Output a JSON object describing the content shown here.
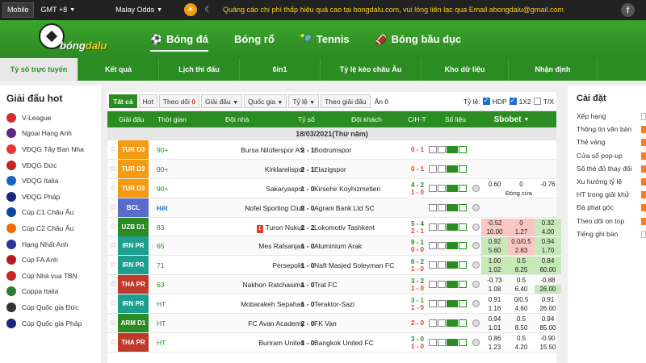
{
  "topbar": {
    "mobile": "Mobile",
    "timezone": "GMT +8",
    "odds_type": "Malay Odds",
    "promo": "Quảng cáo chi phí thấp hiệu quả cao tại bongdalu.com, vui lòng liên lạc qua Email abongdalu@gmail.com",
    "fb": "f"
  },
  "logo": {
    "text_a": "bóng",
    "text_b": "dalu"
  },
  "nav": [
    {
      "label": "Bóng đá",
      "icon": "soccer-ball-icon"
    },
    {
      "label": "Bóng rổ",
      "icon": ""
    },
    {
      "label": "Tennis",
      "icon": "tennis-icon"
    },
    {
      "label": "Bóng bầu dục",
      "icon": "rugby-icon"
    }
  ],
  "subnav": [
    "Tỷ số trực tuyến",
    "Kết quả",
    "Lịch thi đấu",
    "6in1",
    "Tỷ lệ kèo châu Âu",
    "Kho dữ liệu",
    "Nhận định"
  ],
  "left": {
    "title": "Giải đấu hot",
    "items": [
      {
        "label": "V-League",
        "color": "#d32f2f"
      },
      {
        "label": "Ngoại Hạng Anh",
        "color": "#5e2a84"
      },
      {
        "label": "VĐQG Tây Ban Nha",
        "color": "#e53935"
      },
      {
        "label": "VĐQG Đức",
        "color": "#c62828"
      },
      {
        "label": "VĐQG Italia",
        "color": "#1565c0"
      },
      {
        "label": "VĐQG Pháp",
        "color": "#1a237e"
      },
      {
        "label": "Cúp C1 Châu Âu",
        "color": "#0d47a1"
      },
      {
        "label": "Cúp C2 Châu Âu",
        "color": "#ef6c00"
      },
      {
        "label": "Hạng Nhất Anh",
        "color": "#283593"
      },
      {
        "label": "Cúp FA Anh",
        "color": "#b71c1c"
      },
      {
        "label": "Cúp Nhà vua TBN",
        "color": "#c62828"
      },
      {
        "label": "Coppa Italia",
        "color": "#2e7d32"
      },
      {
        "label": "Cúp Quốc gia Đức",
        "color": "#333333"
      },
      {
        "label": "Cúp Quốc gia Pháp",
        "color": "#1a237e"
      }
    ]
  },
  "filters": {
    "all": "Tất cả",
    "hot": "Hot",
    "follow": "Theo dõi",
    "follow_count": "0",
    "league": "Giải đấu",
    "country": "Quốc gia",
    "odds": "Tỷ lệ",
    "by_league": "Theo giải đấu",
    "hidden": "Ẩn",
    "hidden_count": "0",
    "odds_label": "Tỷ lệ:",
    "hdp": "HDP",
    "x12": "1X2",
    "tx": "T/X"
  },
  "thead": {
    "league": "Giải đấu",
    "time": "Thời gian",
    "home": "Đội nhà",
    "score": "Tỷ số",
    "away": "Đội khách",
    "ch": "C/H-T",
    "data": "Số liệu",
    "book": "Sbobet"
  },
  "date": "18/03/2021(Thứ năm)",
  "matches": [
    {
      "league": "TUR D3",
      "lc": "#f39c12",
      "time": "90+",
      "home": "Bursa Nilüferspor AS",
      "score": "2 - 1",
      "away": "Bodrumspor",
      "ch1": "0 - 1",
      "ch1c": "r",
      "ch2": "",
      "ch2c": "",
      "o1": [
        "",
        ""
      ],
      "o2": [
        "",
        ""
      ],
      "o3": [
        "",
        ""
      ]
    },
    {
      "league": "TUR D3",
      "lc": "#f39c12",
      "time": "90+",
      "home": "Kirklarelispor",
      "score": "2 - 1",
      "away": "Elazigspor",
      "ch1": "0 - 1",
      "ch1c": "r",
      "ch2": "",
      "ch2c": "",
      "o1": [
        "",
        ""
      ],
      "o2": [
        "",
        ""
      ],
      "o3": [
        "",
        ""
      ]
    },
    {
      "league": "TUR D3",
      "lc": "#f39c12",
      "time": "90+",
      "home": "Sakaryaspor",
      "score": "1 - 0",
      "away": "Kirsehir Koyhizmetleri",
      "ch1": "4 - 2",
      "ch1c": "g",
      "ch2": "1 - 0",
      "ch2c": "r",
      "o1": [
        "0.60",
        ""
      ],
      "o2": [
        "0",
        "Đóng cửa"
      ],
      "o3": [
        "-0.76",
        ""
      ]
    },
    {
      "league": "BCL",
      "lc": "#5b6cc8",
      "time": "Hết",
      "home": "Nofel Sporting Club",
      "score": "2 - 0",
      "away": "Agrani Bank Ltd SC",
      "ch1": "",
      "ch1c": "",
      "ch2": "",
      "ch2c": "",
      "o1": [
        "",
        ""
      ],
      "o2": [
        "",
        ""
      ],
      "o3": [
        "",
        ""
      ]
    },
    {
      "league": "UZB D1",
      "lc": "#2b8c23",
      "time": "83",
      "home": "Turon Nukus",
      "score": "2 - 2",
      "away": "Lokomotiv Tashkent",
      "ch1": "5 - 4",
      "ch1c": "g",
      "ch2": "2 - 1",
      "ch2c": "r",
      "o1": [
        "-0.52",
        "10.00"
      ],
      "o2": [
        "0",
        "1.27"
      ],
      "o3": [
        "0.32",
        "4.00"
      ],
      "red": "1"
    },
    {
      "league": "IRN PR",
      "lc": "#1e9e8e",
      "time": "65",
      "home": "Mes Rafsanjan",
      "score": "1 - 0",
      "away": "Aluminium Arak",
      "ch1": "9 - 1",
      "ch1c": "g",
      "ch2": "0 - 0",
      "ch2c": "r",
      "o1": [
        "0.92",
        "5.60"
      ],
      "o2": [
        "0.0/0.5",
        "2.83"
      ],
      "o3": [
        "0.94",
        "1.70"
      ]
    },
    {
      "league": "IRN PR",
      "lc": "#1e9e8e",
      "time": "71",
      "home": "Persepolis",
      "score": "1 - 0",
      "away": "Naft Masjed Soleyman FC",
      "ch1": "6 - 2",
      "ch1c": "g",
      "ch2": "1 - 0",
      "ch2c": "r",
      "o1": [
        "1.00",
        "1.02"
      ],
      "o2": [
        "0.5",
        "8.25"
      ],
      "o3": [
        "0.84",
        "60.00"
      ]
    },
    {
      "league": "THA PR",
      "lc": "#c0392b",
      "time": "63",
      "home": "Nakhon Ratchasima",
      "score": "1 - 0",
      "away": "Trat FC",
      "ch1": "3 - 2",
      "ch1c": "g",
      "ch2": "1 - 0",
      "ch2c": "r",
      "o1": [
        "-0.73",
        "1.08"
      ],
      "o2": [
        "0.5",
        "6.40"
      ],
      "o3": [
        "-0.88",
        "26.00"
      ]
    },
    {
      "league": "IRN PR",
      "lc": "#1e9e8e",
      "time": "HT",
      "home": "Mobarakeh Sepahan",
      "score": "1 - 0",
      "away": "Teraktor-Sazi",
      "ch1": "3 - 1",
      "ch1c": "g",
      "ch2": "1 - 0",
      "ch2c": "r",
      "o1": [
        "0.91",
        "1.16"
      ],
      "o2": [
        "0/0.5",
        "4.60"
      ],
      "o3": [
        "0.91",
        "26.00"
      ]
    },
    {
      "league": "ARM D1",
      "lc": "#2b8c23",
      "time": "HT",
      "home": "FC Avan Academy",
      "score": "2 - 0",
      "away": "FK Van",
      "ch1": "2 - 0",
      "ch1c": "r",
      "ch2": "",
      "ch2c": "",
      "o1": [
        "0.94",
        "1.01"
      ],
      "o2": [
        "0.5",
        "8.50"
      ],
      "o3": [
        "0.94",
        "85.00"
      ]
    },
    {
      "league": "THA PR",
      "lc": "#c0392b",
      "time": "HT",
      "home": "Buriram United",
      "score": "1 - 0",
      "away": "Bangkok United FC",
      "ch1": "3 - 0",
      "ch1c": "g",
      "ch2": "1 - 0",
      "ch2c": "r",
      "o1": [
        "0.86",
        "1.23"
      ],
      "o2": [
        "0.5",
        "4.20"
      ],
      "o3": [
        "-0.90",
        "15.50"
      ]
    }
  ],
  "right": {
    "title": "Cài đặt",
    "items": [
      {
        "label": "Xếp hạng",
        "on": false
      },
      {
        "label": "Thông tin văn bản",
        "on": true
      },
      {
        "label": "Thẻ vàng",
        "on": true
      },
      {
        "label": "Cửa sổ pop-up",
        "on": true
      },
      {
        "label": "Số thẻ đỏ thay đổi",
        "on": true
      },
      {
        "label": "Xu hướng tỷ lệ",
        "on": true
      },
      {
        "label": "HT trong giải khử",
        "on": true
      },
      {
        "label": "Đá phạt góc",
        "on": true
      },
      {
        "label": "Theo dõi on top",
        "on": true
      },
      {
        "label": "Tiếng ghi bàn",
        "on": false
      }
    ]
  }
}
